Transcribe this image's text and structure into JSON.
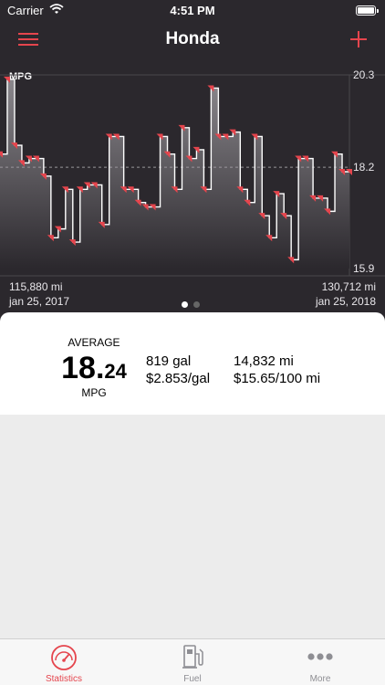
{
  "status_bar": {
    "carrier": "Carrier",
    "time": "4:51 PM"
  },
  "nav": {
    "title": "Honda"
  },
  "chart_data": {
    "type": "line",
    "ylabel": "MPG",
    "y_ticks": [
      "20.3",
      "18.2",
      "15.9"
    ],
    "ylim": [
      15.9,
      20.3
    ],
    "reference_line": 18.2,
    "x": [
      0,
      1,
      2,
      3,
      4,
      5,
      6,
      7,
      8,
      9,
      10,
      11,
      12,
      13,
      14,
      15,
      16,
      17,
      18,
      19,
      20,
      21,
      22,
      23,
      24,
      25,
      26,
      27,
      28,
      29,
      30,
      31,
      32,
      33,
      34,
      35,
      36,
      37,
      38,
      39,
      40,
      41,
      42,
      43,
      44,
      45,
      46,
      47,
      48
    ],
    "values": [
      18.5,
      20.2,
      18.7,
      18.3,
      18.4,
      18.4,
      18.0,
      16.6,
      16.8,
      17.7,
      16.5,
      17.7,
      17.8,
      17.8,
      16.9,
      18.9,
      18.9,
      17.7,
      17.7,
      17.4,
      17.3,
      17.3,
      18.9,
      18.5,
      17.7,
      19.1,
      18.4,
      18.6,
      17.7,
      20.0,
      18.9,
      18.9,
      19.0,
      17.7,
      17.4,
      18.9,
      17.1,
      16.6,
      17.6,
      17.1,
      16.1,
      18.4,
      18.4,
      17.5,
      17.5,
      17.2,
      18.5,
      18.1,
      18.1
    ],
    "x_start": {
      "odometer": "115,880 mi",
      "date": "jan 25, 2017"
    },
    "x_end": {
      "odometer": "130,712 mi",
      "date": "jan 25, 2018"
    },
    "colors": {
      "line": "#ffffff",
      "marker": "#e5454d",
      "fill_top": "#8a878c",
      "fill_bottom": "#2b282d",
      "grid": "#4a474c"
    }
  },
  "pager": {
    "pages": 2,
    "current": 1
  },
  "summary": {
    "average_label": "AVERAGE",
    "average_int": "18.",
    "average_dec": "24",
    "average_unit": "MPG",
    "gallons": "819 gal",
    "price_per_gal": "$2.853/gal",
    "distance": "14,832 mi",
    "cost_per_100": "$15.65/100 mi"
  },
  "tabs": [
    {
      "label": "Statistics",
      "icon": "gauge-icon",
      "active": true
    },
    {
      "label": "Fuel",
      "icon": "fuel-pump-icon",
      "active": false
    },
    {
      "label": "More",
      "icon": "more-dots-icon",
      "active": false
    }
  ],
  "colors": {
    "accent": "#e5454d",
    "header_bg": "#2b282d"
  }
}
